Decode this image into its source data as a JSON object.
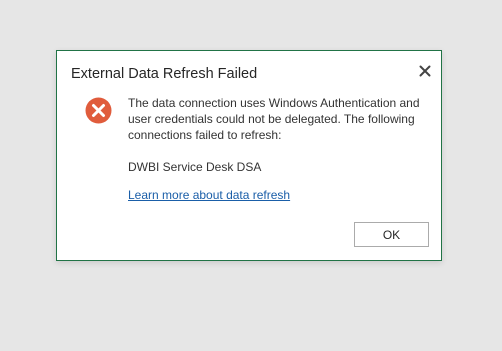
{
  "dialog": {
    "title": "External Data Refresh Failed",
    "close_icon": "close-icon",
    "error_icon": "error-circle-x-icon",
    "message": "The data connection uses Windows Authentication and user credentials could not be delegated. The following connections failed to refresh:",
    "connection_name": "DWBI Service Desk DSA",
    "link_text": "Learn more about data refresh",
    "ok_label": "OK"
  },
  "colors": {
    "dialog_border": "#217346",
    "error_icon": "#e05c3c",
    "link": "#1a5ea8",
    "backdrop": "#e6e6e6"
  }
}
